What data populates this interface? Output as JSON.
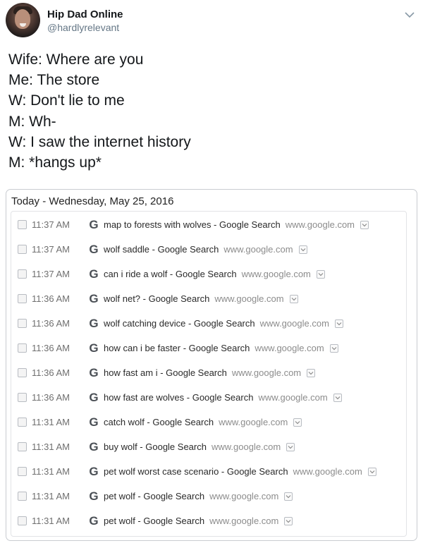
{
  "tweet": {
    "display_name": "Hip Dad Online",
    "handle": "@hardlyrelevant",
    "lines": [
      "Wife: Where are you",
      "Me: The store",
      "W: Don't lie to me",
      "M: Wh-",
      "W: I saw the internet history",
      "M: *hangs up*"
    ]
  },
  "history": {
    "heading": "Today - Wednesday, May 25, 2016",
    "entries": [
      {
        "time": "11:37 AM",
        "title": "map to forests with wolves - Google Search",
        "domain": "www.google.com"
      },
      {
        "time": "11:37 AM",
        "title": "wolf saddle - Google Search",
        "domain": "www.google.com"
      },
      {
        "time": "11:37 AM",
        "title": "can i ride a wolf - Google Search",
        "domain": "www.google.com"
      },
      {
        "time": "11:36 AM",
        "title": "wolf net? - Google Search",
        "domain": "www.google.com"
      },
      {
        "time": "11:36 AM",
        "title": "wolf catching device - Google Search",
        "domain": "www.google.com"
      },
      {
        "time": "11:36 AM",
        "title": "how can i be faster - Google Search",
        "domain": "www.google.com"
      },
      {
        "time": "11:36 AM",
        "title": "how fast am i - Google Search",
        "domain": "www.google.com"
      },
      {
        "time": "11:36 AM",
        "title": "how fast are wolves - Google Search",
        "domain": "www.google.com"
      },
      {
        "time": "11:31 AM",
        "title": "catch wolf - Google Search",
        "domain": "www.google.com"
      },
      {
        "time": "11:31 AM",
        "title": "buy wolf - Google Search",
        "domain": "www.google.com"
      },
      {
        "time": "11:31 AM",
        "title": "pet wolf worst case scenario - Google Search",
        "domain": "www.google.com"
      },
      {
        "time": "11:31 AM",
        "title": "pet wolf - Google Search",
        "domain": "www.google.com"
      },
      {
        "time": "11:31 AM",
        "title": "pet wolf - Google Search",
        "domain": "www.google.com"
      }
    ]
  },
  "icons": {
    "favicon_glyph": "G",
    "menu": "dropdown-arrow-icon",
    "tweet_menu": "chevron-down-icon"
  }
}
